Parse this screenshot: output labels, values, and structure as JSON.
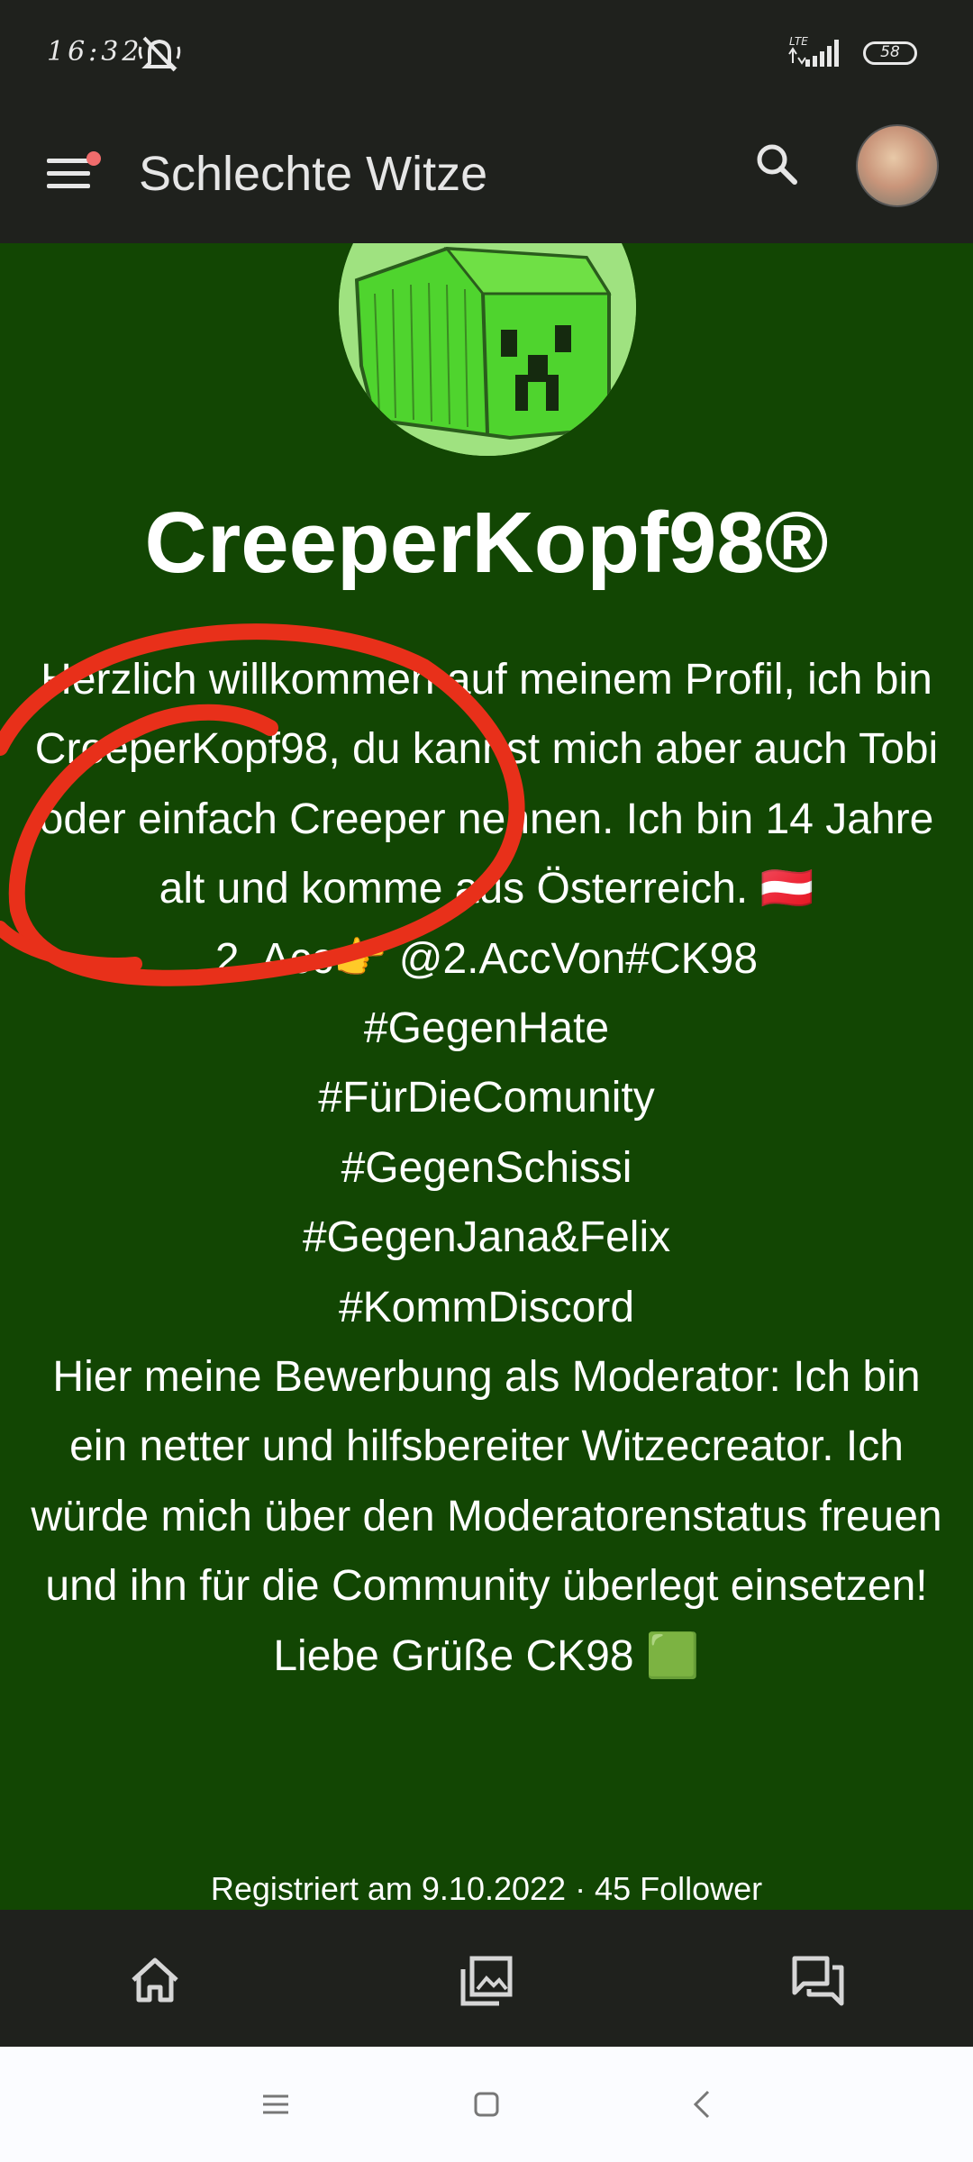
{
  "status_bar": {
    "time": "16:32",
    "network": "LTE",
    "battery": "58"
  },
  "app_bar": {
    "title": "Schlechte Witze"
  },
  "profile": {
    "username": "CreeperKopf98®",
    "bio": "Herzlich willkommen auf meinem Profil, ich bin CreeperKopf98, du kannst mich aber auch Tobi oder einfach Creeper nennen. Ich bin 14 Jahre alt und komme aus Österreich. 🇦🇹\n2. Acc👉 @2.AccVon#CK98\n#GegenHate\n#FürDieComunity\n#GegenSchissi\n#GegenJana&Felix\n#KommDiscord\nHier meine Bewerbung als Moderator: Ich bin ein netter und hilfsbereiter Witzecreator. Ich würde mich über den Moderatorenstatus freuen und ihn für die Community überlegt einsetzen! Liebe Grüße CK98 🟩",
    "registered": "Registriert am 9.10.2022 · 45 Follower"
  },
  "colors": {
    "profile_background": "#124603",
    "bars": "#1f211d",
    "annotation": "#e8301a"
  },
  "icons": [
    "menu-icon",
    "search-icon",
    "home-icon",
    "gallery-icon",
    "chat-icon"
  ]
}
